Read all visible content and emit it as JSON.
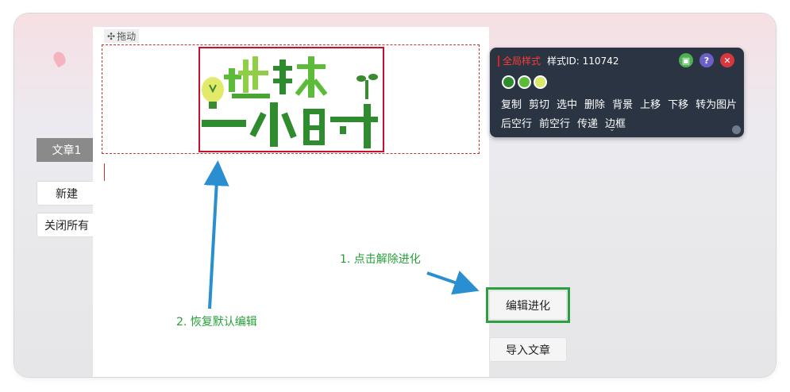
{
  "sidebar": {
    "active_tab": "文章1",
    "new_button": "新建",
    "close_all_button": "关闭所有"
  },
  "editor": {
    "drag_label": "拖动",
    "drag_icon": "move-icon",
    "image_title": "地球一小时"
  },
  "toolbar": {
    "global_style_label": "全局样式",
    "style_id": "样式ID: 110742",
    "icons": [
      "pin-icon",
      "help-icon",
      "close-icon"
    ],
    "swatches": [
      "#2e8b2e",
      "#5dbb3a",
      "#d7e86a"
    ],
    "row1": [
      "复制",
      "剪切",
      "选中",
      "删除",
      "背景",
      "上移",
      "下移",
      "转为图片"
    ],
    "row2": [
      "后空行",
      "前空行",
      "传递",
      "边框"
    ],
    "expand_icon": "chevron-down-icon"
  },
  "actions": {
    "edit_evolution": "编辑进化",
    "import_article": "导入文章"
  },
  "annotations": {
    "step1": "1. 点击解除进化",
    "step2": "2. 恢复默认编辑"
  },
  "colors": {
    "accent_green": "#24a038",
    "selection_red": "#c8102e",
    "toolbar_bg": "#2b3442"
  }
}
